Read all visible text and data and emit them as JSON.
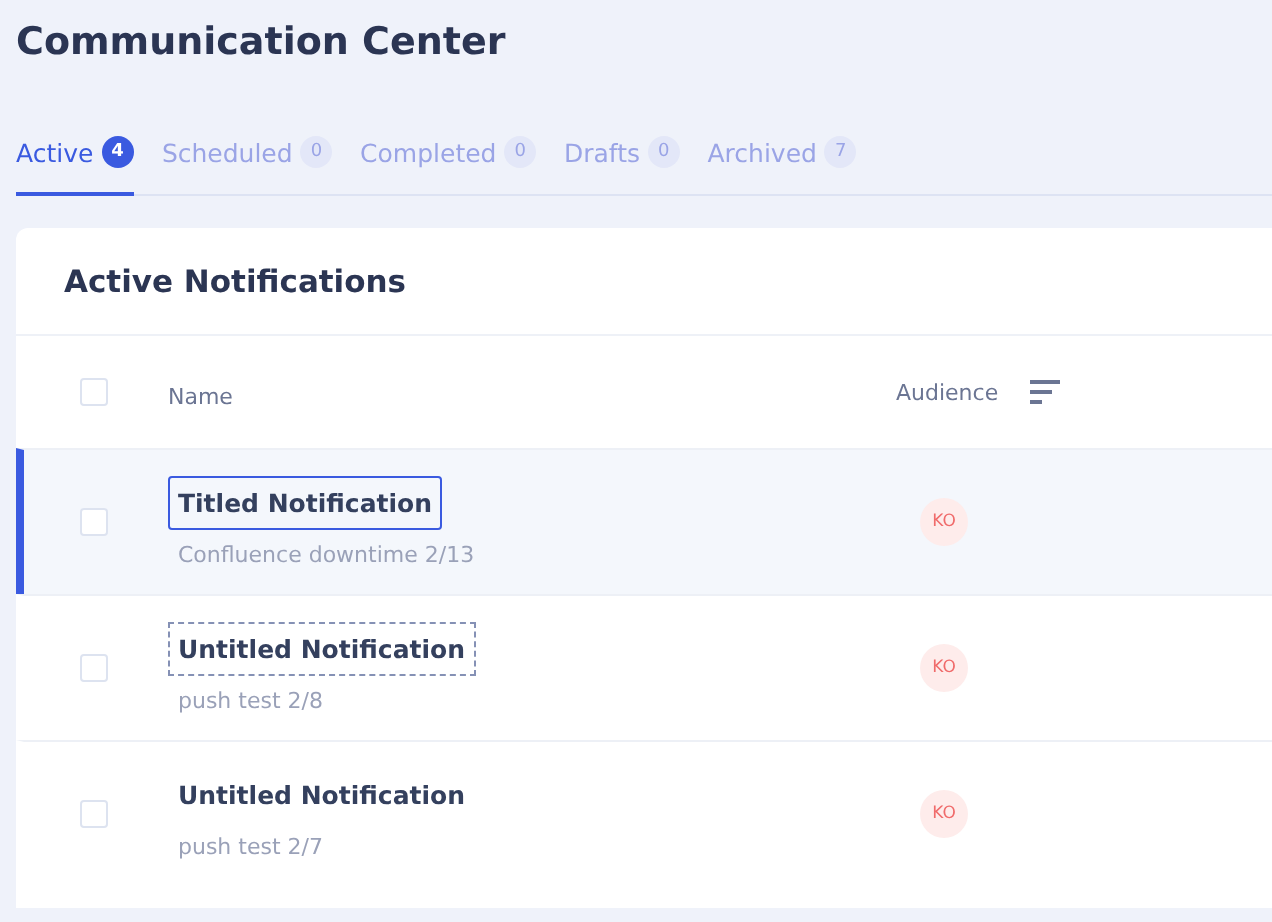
{
  "page_title": "Communication Center",
  "tabs": [
    {
      "label": "Active",
      "count": "4",
      "selected": true
    },
    {
      "label": "Scheduled",
      "count": "0",
      "selected": false
    },
    {
      "label": "Completed",
      "count": "0",
      "selected": false
    },
    {
      "label": "Drafts",
      "count": "0",
      "selected": false
    },
    {
      "label": "Archived",
      "count": "7",
      "selected": false
    }
  ],
  "card_title": "Active Notifications",
  "columns": {
    "select_all_checked": false,
    "name": "Name",
    "audience": "Audience"
  },
  "rows": [
    {
      "title": "Titled Notification",
      "subtitle": "Confluence downtime 2/13",
      "audience": "KO",
      "selected": true,
      "checked": false,
      "outlined": true,
      "focused": false
    },
    {
      "title": "Untitled Notification",
      "subtitle": "push test 2/8",
      "audience": "KO",
      "selected": false,
      "checked": false,
      "outlined": false,
      "focused": true
    },
    {
      "title": "Untitled Notification",
      "subtitle": "push test 2/7",
      "audience": "KO",
      "selected": false,
      "checked": false,
      "outlined": false,
      "focused": false
    }
  ]
}
